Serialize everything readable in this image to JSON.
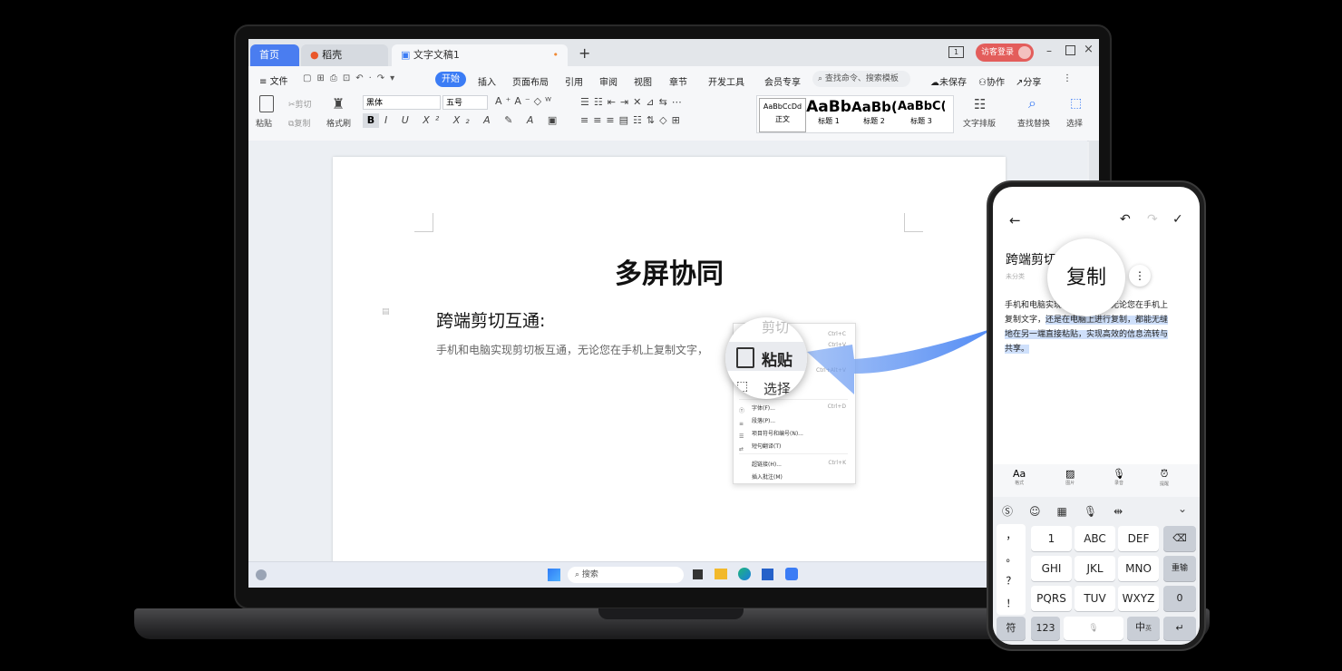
{
  "wps": {
    "tabs": {
      "home": "首页",
      "daoke": "稻壳",
      "doc": "文字文稿1",
      "new": "+"
    },
    "window": {
      "page_indicator": "1",
      "login": "访客登录"
    },
    "menu": {
      "file": "文件",
      "items": [
        "开始",
        "插入",
        "页面布局",
        "引用",
        "审阅",
        "视图",
        "章节",
        "开发工具",
        "会员专享"
      ],
      "search": "查找命令、搜索模板",
      "unsaved": "未保存",
      "collab": "协作",
      "share": "分享"
    },
    "toolbar": {
      "paste": "粘贴",
      "cut": "剪切",
      "copy": "复制",
      "format_painter": "格式刷",
      "font": "黑体",
      "size": "五号",
      "styles": [
        {
          "preview": "AaBbCcDd",
          "name": "正文"
        },
        {
          "preview": "AaBb",
          "name": "标题 1"
        },
        {
          "preview": "AaBb(",
          "name": "标题 2"
        },
        {
          "preview": "AaBbC(",
          "name": "标题 3"
        }
      ],
      "text_layout": "文字排版",
      "find_replace": "查找替换",
      "select": "选择"
    },
    "document": {
      "title": "多屏协同",
      "heading": "跨端剪切互通:",
      "body": "手机和电脑实现剪切板互通，无论您在手机上复制文字，"
    },
    "context_menu": {
      "zoom_top": "剪切",
      "zoom_paste": "粘贴",
      "zoom_bottom": "选择",
      "items": [
        {
          "label": "字体(F)...",
          "key": "Ctrl+D"
        },
        {
          "label": "段落(P)...",
          "key": ""
        },
        {
          "label": "项目符号和编号(N)...",
          "key": ""
        },
        {
          "label": "短句翻译(T)",
          "key": ""
        },
        {
          "label": "超链接(H)...",
          "key": "Ctrl+K"
        },
        {
          "label": "插入批注(M)",
          "key": ""
        }
      ],
      "hidden_keys": [
        "Ctrl+C",
        "Ctrl+V",
        "Ctrl+Alt+V"
      ]
    },
    "taskbar": {
      "search": "搜索"
    }
  },
  "phone": {
    "note_title": "跨端剪切",
    "note_meta": "未分类",
    "copy_bubble": "复制",
    "body_plain_1": "手机和电脑实现剪切板互通，无论您在手机上",
    "body_plain_2": "复制文字，",
    "body_selected_1": "还是在电脑上进行复制，都能无缝",
    "body_selected_2": "地在另一端直接粘贴，实现高效的信息流转与",
    "body_selected_3": "共享。",
    "tools": [
      {
        "icon": "Aa",
        "label": "格式"
      },
      {
        "icon": "image-icon",
        "label": "图片"
      },
      {
        "icon": "mic-icon",
        "label": "录音"
      },
      {
        "icon": "alarm-icon",
        "label": "提醒"
      }
    ],
    "keyboard": {
      "punct": [
        "，",
        "。",
        "？",
        "！"
      ],
      "rows": [
        [
          "1",
          "ABC",
          "DEF"
        ],
        [
          "GHI",
          "JKL",
          "MNO"
        ],
        [
          "PQRS",
          "TUV",
          "WXYZ"
        ]
      ],
      "row_hints": [
        [
          "",
          "2",
          "3"
        ],
        [
          "4",
          "5",
          "6"
        ],
        [
          "7",
          "8",
          "9"
        ]
      ],
      "delete": "⌫",
      "redo": "重输",
      "zero": "0",
      "symbol": "符",
      "num": "123",
      "lang": "中",
      "lang_sub": "英",
      "enter": "↵"
    }
  },
  "colors": {
    "accent": "#3b7cf5",
    "login": "#e35d5b",
    "selection": "#cfe0fb"
  }
}
